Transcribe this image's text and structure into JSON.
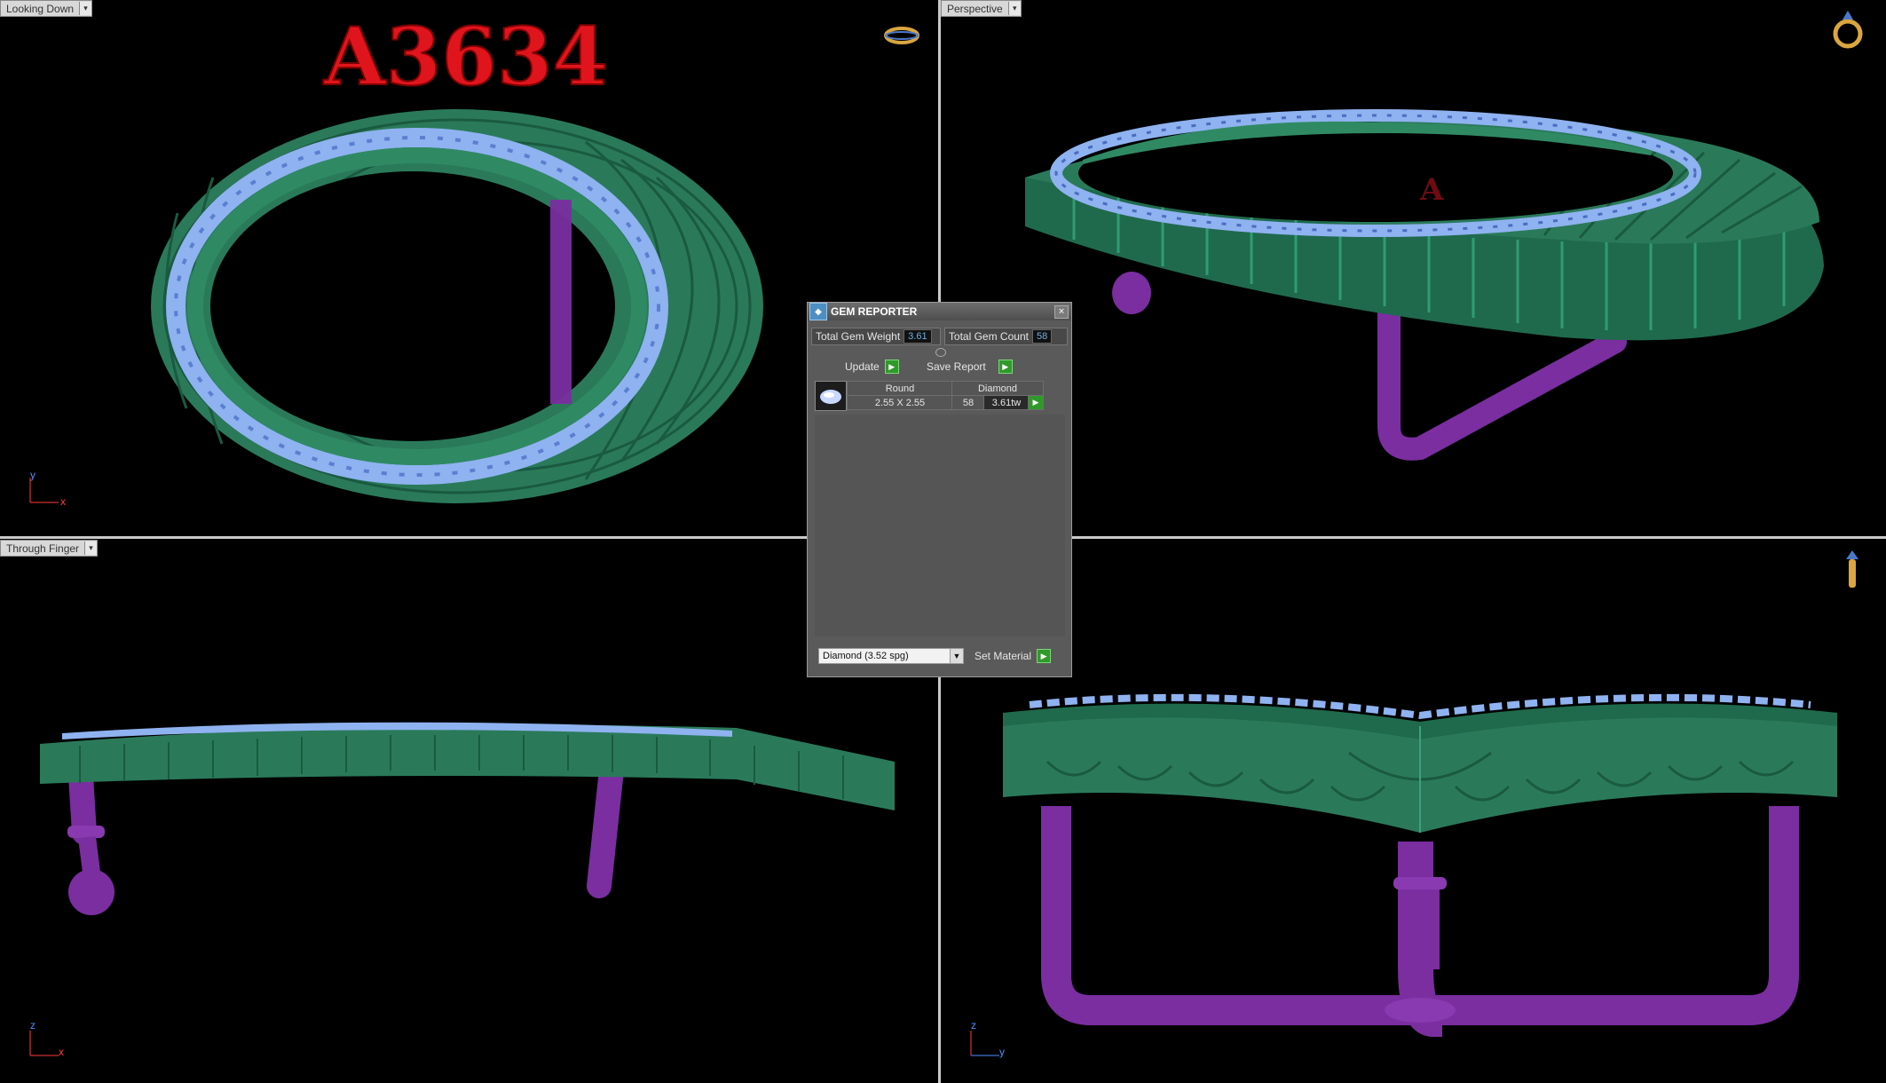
{
  "viewports": {
    "top_left": {
      "label": "Looking Down",
      "axis_v": "y",
      "axis_h": "x"
    },
    "top_right": {
      "label": "Perspective"
    },
    "bottom_left": {
      "label": "Through Finger",
      "axis_v": "z",
      "axis_h": "x"
    },
    "bottom_right": {
      "axis_v": "z",
      "axis_h": "y"
    }
  },
  "watermark_text": "A3634",
  "gem_reporter": {
    "title": "GEM REPORTER",
    "total_gem_weight_label": "Total Gem Weight",
    "total_gem_weight_value": "3.61",
    "total_gem_count_label": "Total Gem Count",
    "total_gem_count_value": "58",
    "update_label": "Update",
    "save_report_label": "Save Report",
    "row": {
      "shape": "Round",
      "material": "Diamond",
      "size": "2.55 X 2.55",
      "count": "58",
      "weight": "3.61tw"
    },
    "material_select": "Diamond     (3.52 spg)",
    "set_material_label": "Set Material"
  },
  "colors": {
    "metal_green": "#2a7a5a",
    "gem_blue": "#8fb2f0",
    "support_purple": "#7a2ea0",
    "watermark_red": "#e0141c"
  },
  "icons": [
    "ring-top-icon",
    "ring-perspective-icon",
    "ring-side-icon"
  ]
}
